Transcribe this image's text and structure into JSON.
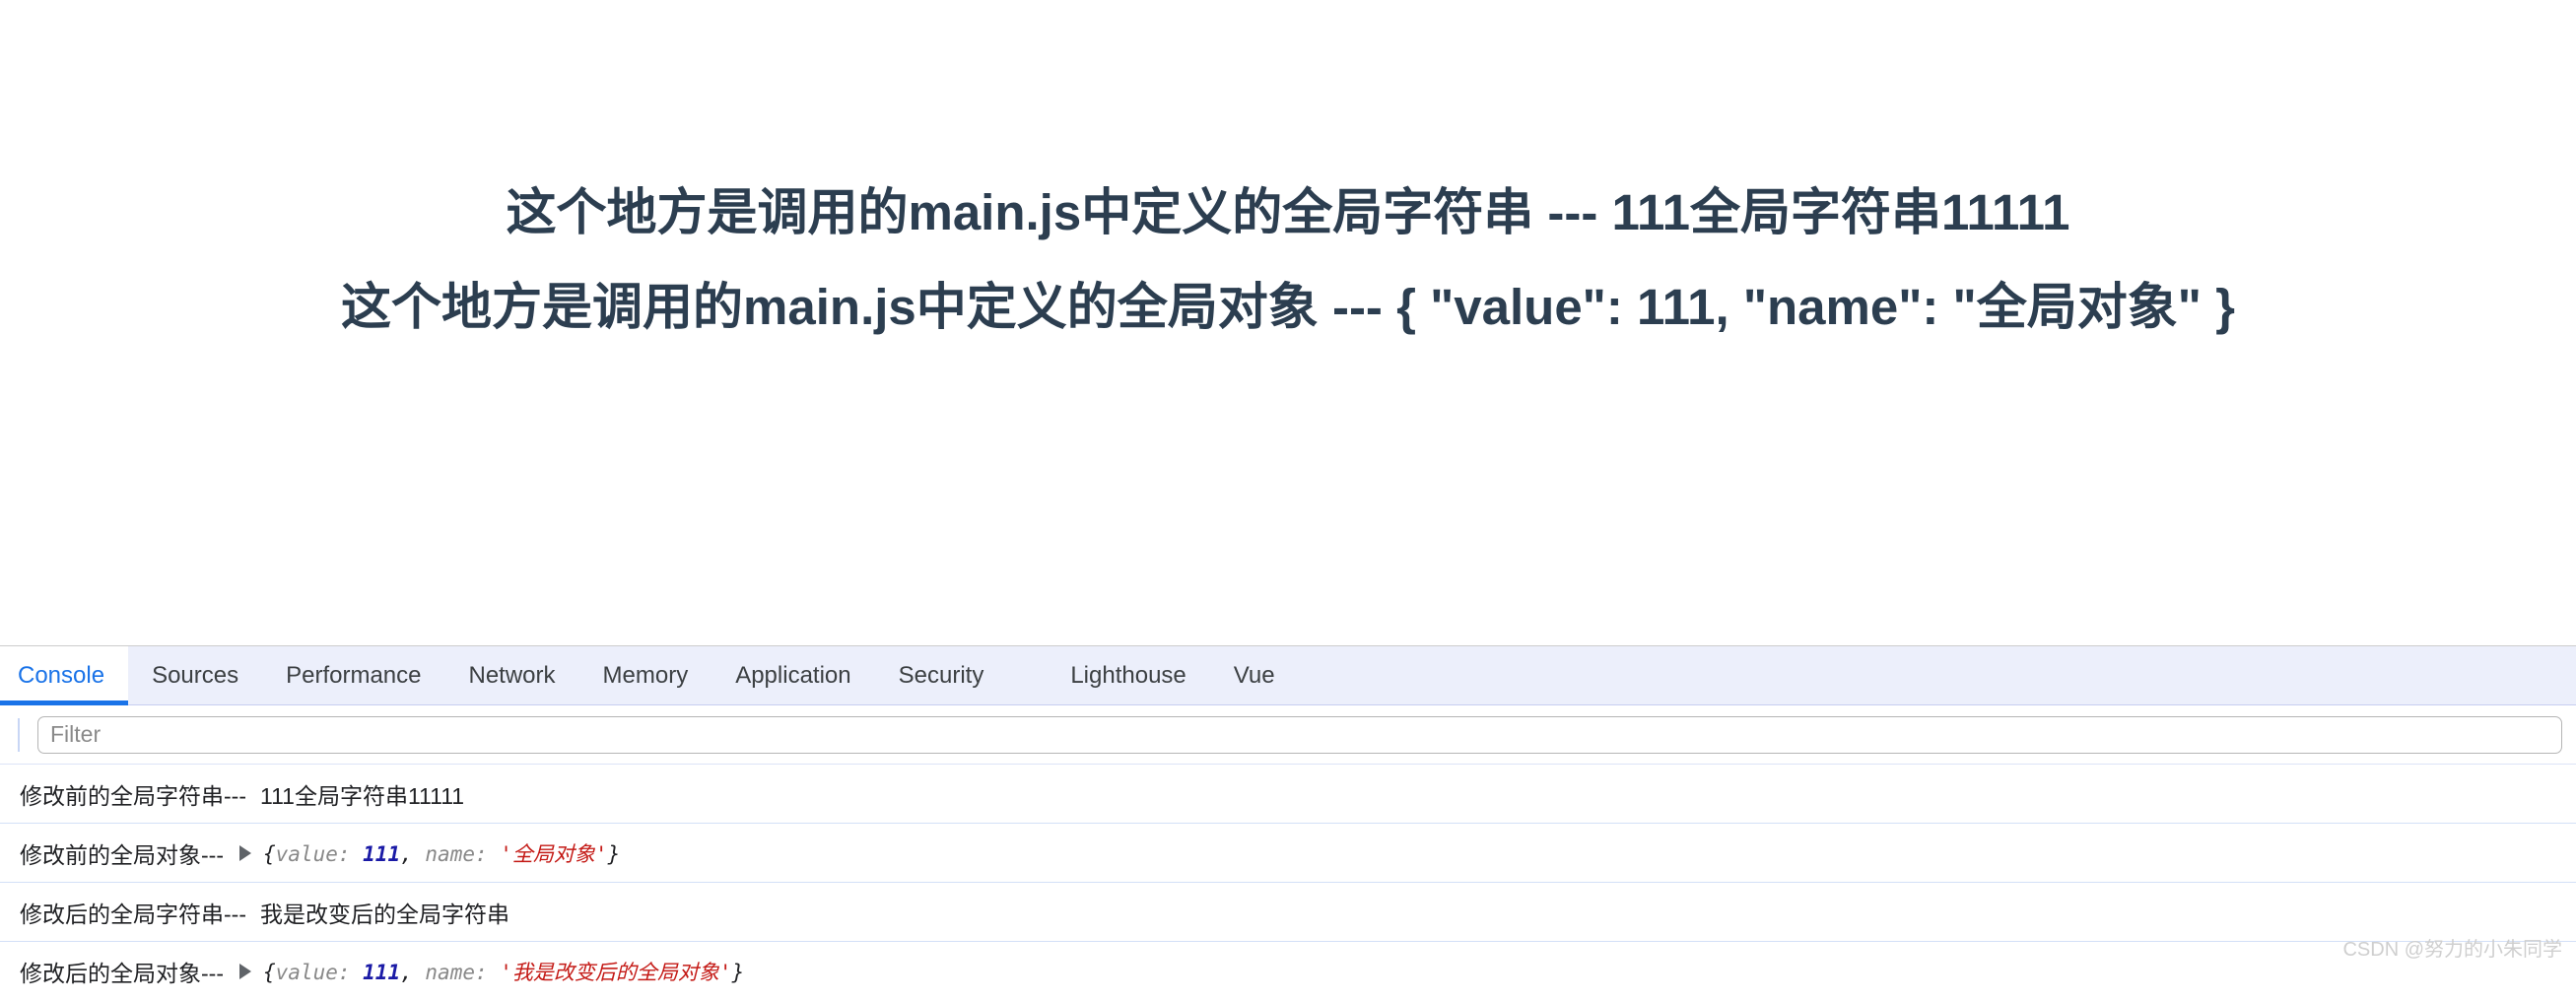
{
  "page": {
    "headings": [
      "这个地方是调用的main.js中定义的全局字符串 --- 111全局字符串11111",
      "这个地方是调用的main.js中定义的全局对象 --- { \"value\": 111, \"name\": \"全局对象\" }"
    ],
    "text_color": "#2c3e50"
  },
  "devtools": {
    "tabs": [
      {
        "label": "Console",
        "active": true
      },
      {
        "label": "Sources",
        "active": false
      },
      {
        "label": "Performance",
        "active": false
      },
      {
        "label": "Network",
        "active": false
      },
      {
        "label": "Memory",
        "active": false
      },
      {
        "label": "Application",
        "active": false
      },
      {
        "label": "Security",
        "active": false
      },
      {
        "label": "Lighthouse",
        "active": false
      },
      {
        "label": "Vue",
        "active": false
      }
    ],
    "active_tab_color": "#1a73e8",
    "filter": {
      "value": "",
      "placeholder": "Filter"
    },
    "console_rows": [
      {
        "label": "修改前的全局字符串---",
        "kind": "text",
        "value": "111全局字符串11111"
      },
      {
        "label": "修改前的全局对象---",
        "kind": "object",
        "expander": "▶",
        "open_brace": "{",
        "key1": "value:",
        "num": "111",
        "comma": ",",
        "key2": "name:",
        "str": "'全局对象'",
        "close_brace": "}"
      },
      {
        "label": "修改后的全局字符串---",
        "kind": "text",
        "value": "我是改变后的全局字符串"
      },
      {
        "label": "修改后的全局对象---",
        "kind": "object",
        "expander": "▶",
        "open_brace": "{",
        "key1": "value:",
        "num": "111",
        "comma": ",",
        "key2": "name:",
        "str": "'我是改变后的全局对象'",
        "close_brace": "}"
      }
    ],
    "number_color": "#1a1aa6",
    "string_color": "#c41a16"
  },
  "watermark": "CSDN @努力的小朱同学"
}
